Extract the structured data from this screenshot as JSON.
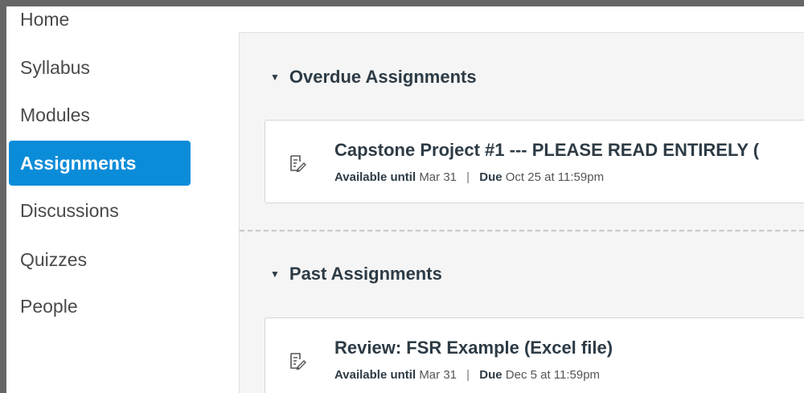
{
  "sidebar": {
    "items": [
      {
        "label": "Home"
      },
      {
        "label": "Syllabus"
      },
      {
        "label": "Modules"
      },
      {
        "label": "Assignments",
        "active": true
      },
      {
        "label": "Discussions"
      },
      {
        "label": "Quizzes"
      },
      {
        "label": "People"
      }
    ]
  },
  "groups": [
    {
      "title": "Overdue Assignments",
      "assignments": [
        {
          "title": "Capstone Project #1 --- PLEASE READ ENTIRELY (",
          "available_label": "Available until",
          "available_date": "Mar 31",
          "separator": "|",
          "due_label": "Due",
          "due_date": "Oct 25 at 11:59pm"
        }
      ]
    },
    {
      "title": "Past Assignments",
      "assignments": [
        {
          "title": "Review: FSR Example (Excel file)",
          "available_label": "Available until",
          "available_date": "Mar 31",
          "separator": "|",
          "due_label": "Due",
          "due_date": "Dec 5 at 11:59pm"
        }
      ]
    }
  ],
  "icons": {
    "group_toggle": "caret-down-icon",
    "assignment": "assignment-icon"
  },
  "colors": {
    "active_nav": "#0b8cd9",
    "text": "#2d3b45"
  }
}
